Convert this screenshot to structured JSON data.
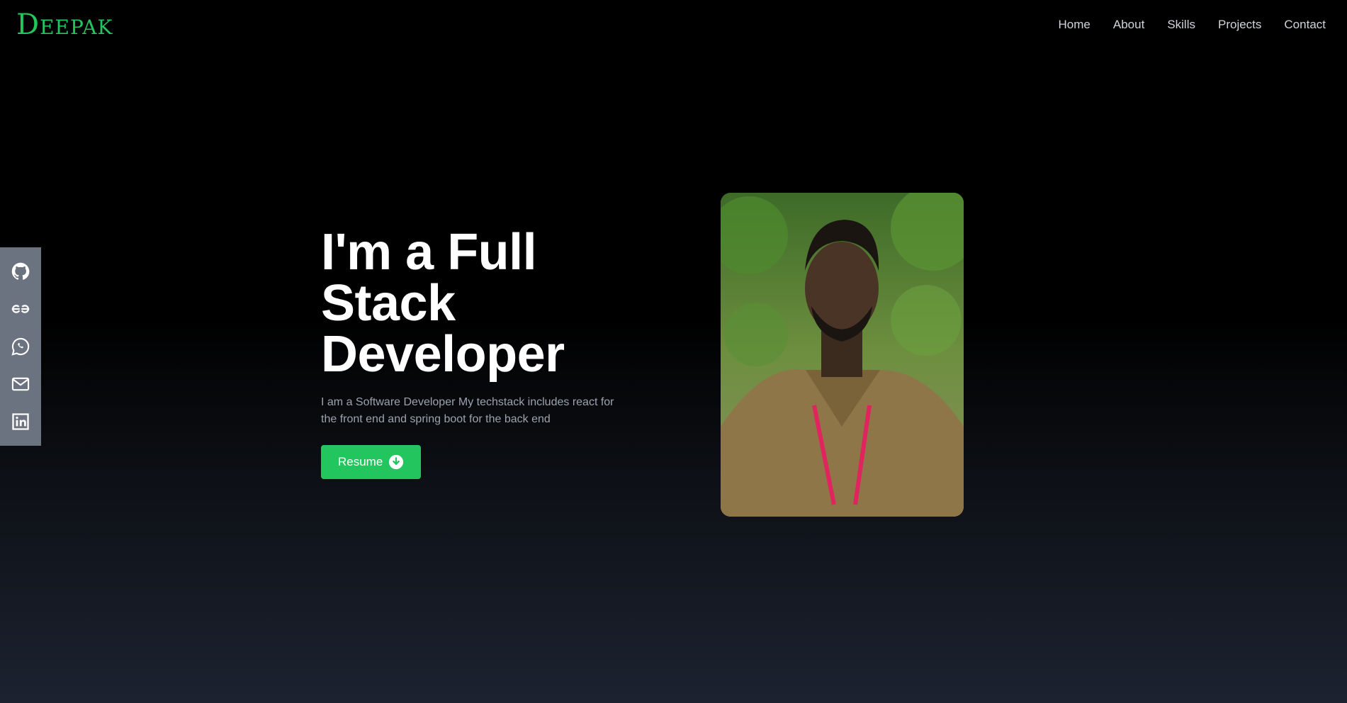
{
  "header": {
    "logo": "Deepak",
    "nav": [
      "Home",
      "About",
      "Skills",
      "Projects",
      "Contact"
    ]
  },
  "social": {
    "icons": [
      "github-icon",
      "geeksforgeeks-icon",
      "whatsapp-icon",
      "mail-icon",
      "linkedin-icon"
    ]
  },
  "hero": {
    "headline_line1": "I'm a Full",
    "headline_line2": "Stack",
    "headline_line3": "Developer",
    "tagline": "I am a Software Developer My techstack includes react for the front end and spring boot for the back end",
    "resume_label": "Resume"
  },
  "colors": {
    "accent": "#22c55e",
    "background": "#000000",
    "social_bar": "#6b7280"
  }
}
